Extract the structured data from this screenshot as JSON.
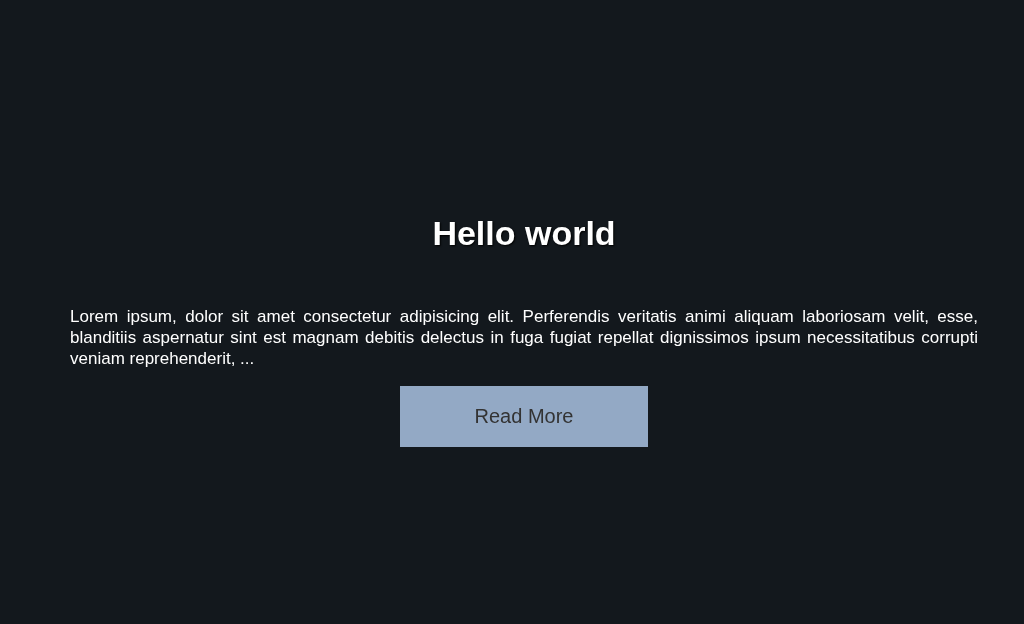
{
  "heading": "Hello world",
  "body": "Lorem ipsum, dolor sit amet consectetur adipisicing elit. Perferendis veritatis animi aliquam laboriosam velit, esse, blanditiis aspernatur sint est magnam debitis delectus in fuga fugiat repellat dignissimos ipsum necessitatibus corrupti veniam reprehenderit, ...",
  "button": {
    "label": "Read More"
  }
}
